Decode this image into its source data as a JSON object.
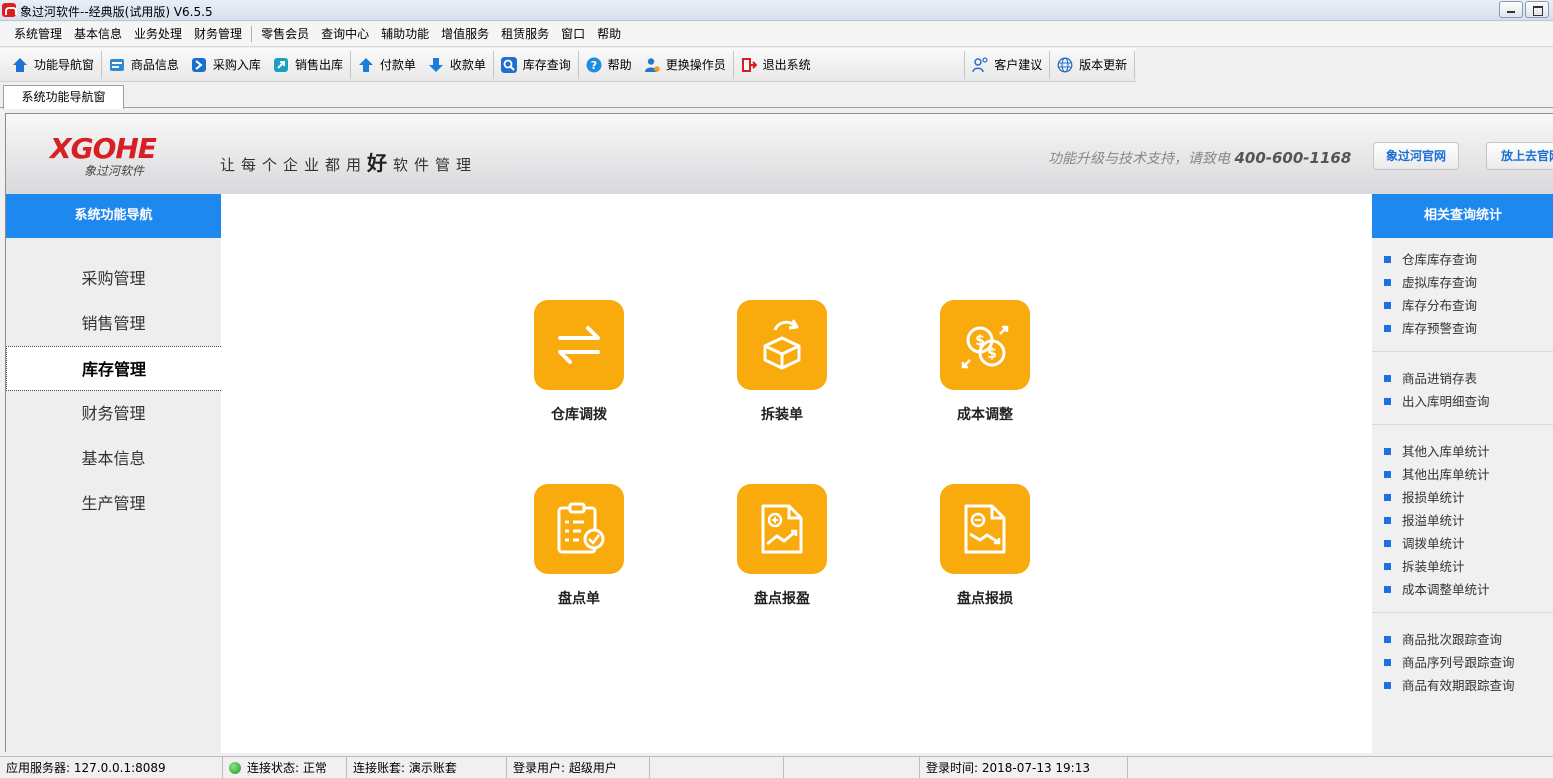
{
  "window": {
    "title": "象过河软件--经典版(试用版) V6.5.5"
  },
  "menu": [
    "系统管理",
    "基本信息",
    "业务处理",
    "财务管理",
    "零售会员",
    "查询中心",
    "辅助功能",
    "增值服务",
    "租赁服务",
    "窗口",
    "帮助"
  ],
  "toolbar": [
    {
      "label": "功能导航窗",
      "icon": "home-icon",
      "color": "#1e72d6"
    },
    {
      "label": "商品信息",
      "icon": "product-icon",
      "color": "#2a8ad8"
    },
    {
      "label": "采购入库",
      "icon": "purchase-in-icon",
      "color": "#1b6fd0"
    },
    {
      "label": "销售出库",
      "icon": "sales-out-icon",
      "color": "#1aa0c0"
    },
    {
      "label": "付款单",
      "icon": "payment-icon",
      "color": "#1c7ed8"
    },
    {
      "label": "收款单",
      "icon": "receipt-icon",
      "color": "#1c7ed8"
    },
    {
      "label": "库存查询",
      "icon": "search-icon",
      "color": "#1e6fd0"
    },
    {
      "label": "帮助",
      "icon": "help-icon",
      "color": "#1d8fe0"
    },
    {
      "label": "更换操作员",
      "icon": "switch-user-icon",
      "color": "#2872c8"
    },
    {
      "label": "退出系统",
      "icon": "exit-icon",
      "color": "#d81e1e"
    },
    {
      "label": "客户建议",
      "icon": "feedback-icon",
      "color": "#2a6fc2"
    },
    {
      "label": "版本更新",
      "icon": "globe-icon",
      "color": "#2a6fc2"
    }
  ],
  "tab": {
    "label": "系统功能导航窗"
  },
  "header": {
    "logo_word": "XGOHE",
    "logo_cn": "象过河软件",
    "slogan_a": "让每个企业都用",
    "slogan_b": "好",
    "slogan_c": "软件管理",
    "support_text": "功能升级与技术支持，请致电",
    "support_phone": "400-600-1168",
    "btn_site": "象过河官网",
    "btn_cloud": "放上去官网"
  },
  "leftnav": {
    "title": "系统功能导航",
    "items": [
      "采购管理",
      "销售管理",
      "库存管理",
      "财务管理",
      "基本信息",
      "生产管理"
    ],
    "active": "库存管理"
  },
  "tiles": [
    {
      "label": "仓库调拨",
      "icon": "transfer-icon"
    },
    {
      "label": "拆装单",
      "icon": "unpack-box-icon"
    },
    {
      "label": "成本调整",
      "icon": "cost-adjust-icon"
    },
    {
      "label": "盘点单",
      "icon": "inventory-clipboard-icon"
    },
    {
      "label": "盘点报盈",
      "icon": "inventory-gain-icon"
    },
    {
      "label": "盘点报损",
      "icon": "inventory-loss-icon"
    }
  ],
  "rightpanel": {
    "title": "相关查询统计",
    "groups": [
      [
        "仓库库存查询",
        "虚拟库存查询",
        "库存分布查询",
        "库存预警查询"
      ],
      [
        "商品进销存表",
        "出入库明细查询"
      ],
      [
        "其他入库单统计",
        "其他出库单统计",
        "报损单统计",
        "报溢单统计",
        "调拨单统计",
        "拆装单统计",
        "成本调整单统计"
      ],
      [
        "商品批次跟踪查询",
        "商品序列号跟踪查询",
        "商品有效期跟踪查询"
      ]
    ]
  },
  "status": {
    "server": "应用服务器: 127.0.0.1:8089",
    "conn": "连接状态: 正常",
    "account": "连接账套: 演示账套",
    "user": "登录用户: 超级用户",
    "login_time": "登录时间: 2018-07-13 19:13"
  }
}
